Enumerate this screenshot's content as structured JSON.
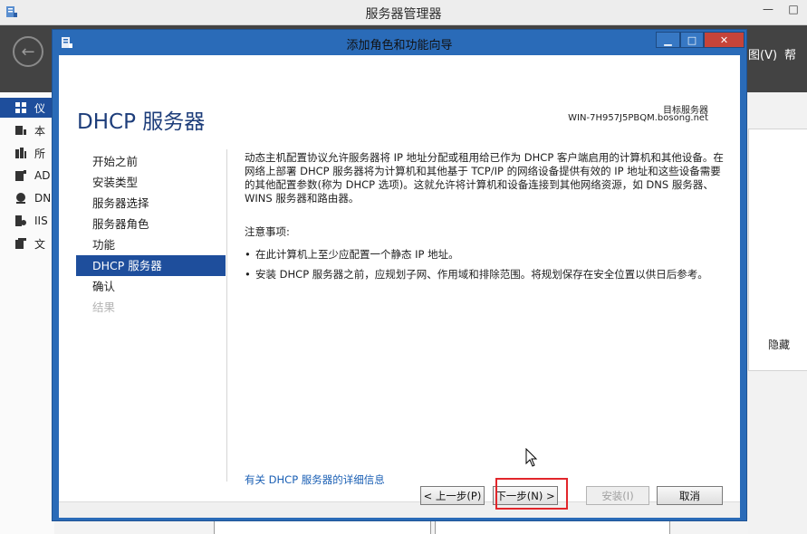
{
  "background_window": {
    "title": "服务器管理器",
    "menu_view": "图(V)",
    "menu_trailing": "帮",
    "sidebar_items": [
      {
        "label": "仪",
        "icon": "dashboard-icon",
        "active": true
      },
      {
        "label": "本",
        "icon": "server-icon",
        "active": false
      },
      {
        "label": "所",
        "icon": "servers-icon",
        "active": false
      },
      {
        "label": "AD",
        "icon": "ad-icon",
        "active": false
      },
      {
        "label": "DN",
        "icon": "dns-icon",
        "active": false
      },
      {
        "label": "IIS",
        "icon": "iis-icon",
        "active": false
      },
      {
        "label": "文",
        "icon": "files-icon",
        "active": false
      }
    ],
    "hide_label": "隐藏"
  },
  "dialog": {
    "title": "添加角色和功能向导",
    "heading": "DHCP 服务器",
    "target_label": "目标服务器",
    "target_value": "WIN-7H957J5PBQM.bosong.net",
    "nav": [
      {
        "label": "开始之前",
        "state": "normal"
      },
      {
        "label": "安装类型",
        "state": "normal"
      },
      {
        "label": "服务器选择",
        "state": "normal"
      },
      {
        "label": "服务器角色",
        "state": "normal"
      },
      {
        "label": "功能",
        "state": "normal"
      },
      {
        "label": "DHCP 服务器",
        "state": "active"
      },
      {
        "label": "确认",
        "state": "normal"
      },
      {
        "label": "结果",
        "state": "disabled"
      }
    ],
    "description": "动态主机配置协议允许服务器将 IP 地址分配或租用给已作为 DHCP 客户端启用的计算机和其他设备。在网络上部署 DHCP 服务器将为计算机和其他基于 TCP/IP 的网络设备提供有效的 IP 地址和这些设备需要的其他配置参数(称为 DHCP 选项)。这就允许将计算机和设备连接到其他网络资源，如 DNS 服务器、WINS 服务器和路由器。",
    "notes_title": "注意事项:",
    "notes": [
      "在此计算机上至少应配置一个静态 IP 地址。",
      "安装 DHCP 服务器之前，应规划子网、作用域和排除范围。将规划保存在安全位置以供日后参考。"
    ],
    "more_info_link": "有关 DHCP 服务器的详细信息",
    "buttons": {
      "previous": "< 上一步(P)",
      "next": "下一步(N) >",
      "install": "安装(I)",
      "cancel": "取消"
    }
  },
  "colors": {
    "dialog_frame": "#2a6bb8",
    "nav_active": "#1e4e9c",
    "link": "#1a5fb4",
    "highlight_box": "#e2262b",
    "close_button": "#c6443a"
  }
}
